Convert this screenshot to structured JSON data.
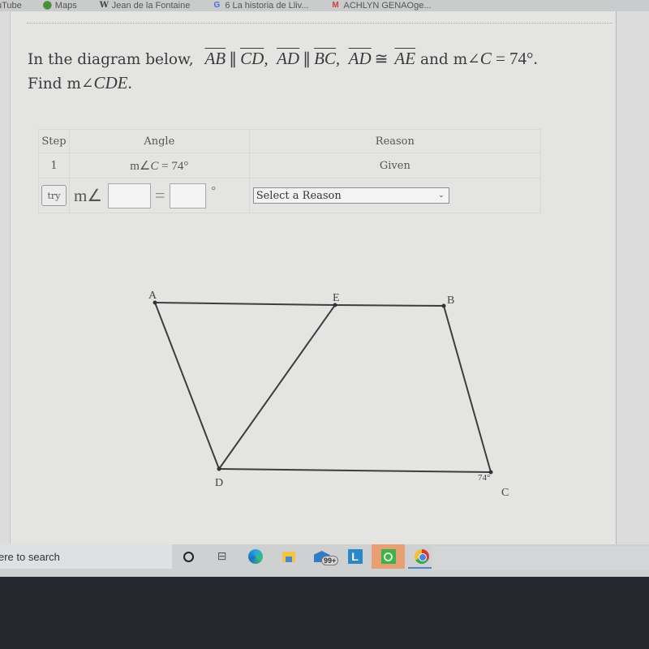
{
  "bookmarks": [
    {
      "label": "uTube",
      "icon": "youtube-icon"
    },
    {
      "label": "Maps",
      "icon": "maps-pin-icon"
    },
    {
      "label": "Jean de la Fontaine",
      "icon": "wikipedia-icon"
    },
    {
      "label": "6 La historia de Lliv...",
      "icon": "google-icon"
    },
    {
      "label": "ACHLYN GENAOge...",
      "icon": "gmail-icon"
    }
  ],
  "problem": {
    "intro": "In the diagram below,",
    "seg1": "AB",
    "parallel": "∥",
    "seg2": "CD",
    "seg3": "AD",
    "seg4": "BC",
    "seg5": "AD",
    "congruent": "≅",
    "seg6": "AE",
    "and": "and m∠",
    "angle_letter": "C",
    "equals_value": " = 74°.",
    "find_prefix": "Find m∠",
    "find_angle": "CDE",
    "find_suffix": "."
  },
  "table": {
    "headers": {
      "step": "Step",
      "angle": "Angle",
      "reason": "Reason"
    },
    "rows": [
      {
        "step": "1",
        "angle_prefix": "m∠",
        "angle_var": "C",
        "angle_value": " = 74°",
        "reason": "Given"
      }
    ],
    "entry": {
      "try_label": "try",
      "angle_prefix": "m∠",
      "angle_input_value": "",
      "equals": "=",
      "value_input_value": "",
      "degree": "°",
      "reason_select": "Select a Reason"
    }
  },
  "diagram": {
    "labels": {
      "A": "A",
      "B": "B",
      "C": "C",
      "D": "D",
      "E": "E"
    },
    "angle_label": "74°",
    "line_color": "#3d3d3d"
  },
  "taskbar": {
    "search_text": "ere to search",
    "mail_badge": "99+",
    "l_app_letter": "L"
  }
}
